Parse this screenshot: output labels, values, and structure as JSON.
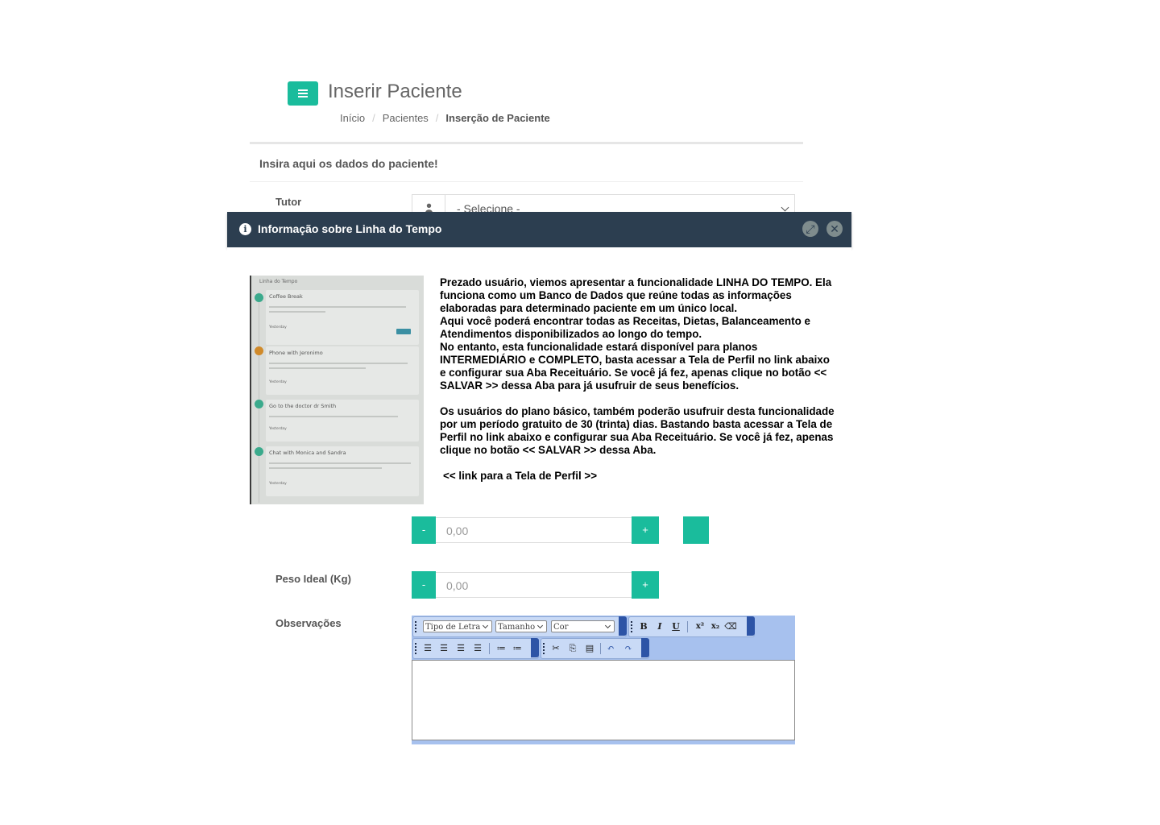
{
  "header": {
    "menu_icon": "bars-icon",
    "title": "Inserir Paciente",
    "breadcrumb": [
      "Início",
      "Pacientes",
      "Inserção de Paciente"
    ],
    "breadcrumb_sep": "/"
  },
  "panel": {
    "heading": "Insira aqui os dados do paciente!"
  },
  "form": {
    "tutor": {
      "label": "Tutor",
      "value": "- Selecione -",
      "icon": "user-icon"
    },
    "peso_atual": {
      "value": "0,00",
      "minus": "-",
      "plus": "+"
    },
    "peso_ideal": {
      "label": "Peso Ideal (Kg)",
      "value": "0,00",
      "minus": "-",
      "plus": "+"
    },
    "observacoes": {
      "label": "Observações"
    }
  },
  "editor": {
    "font_select": "Tipo de Letra",
    "size_select": "Tamanho",
    "color_select": "Cor",
    "bold": "B",
    "italic": "I",
    "underline": "U"
  },
  "modal": {
    "title": "Informação sobre Linha do Tempo",
    "icons": [
      "info-icon",
      "expand-icon",
      "close-icon"
    ],
    "paragraph1": "Prezado usuário, viemos apresentar a funcionalidade LINHA DO TEMPO. Ela funciona como um Banco de Dados que reúne todas as informações elaboradas para determinado paciente em um único local.",
    "paragraph2": "Aqui você poderá encontrar todas as Receitas, Dietas, Balanceamento e Atendimentos disponibilizados ao longo do tempo.",
    "paragraph3": "No entanto, esta funcionalidade estará disponível para planos INTERMEDIÁRIO e COMPLETO, basta acessar a Tela de Perfil no link abaixo e configurar sua Aba Receituário. Se você já fez, apenas clique no botão << SALVAR >> dessa Aba para já usufruir de seus benefícios.",
    "paragraph4": "Os usuários do plano básico, também poderão usufruir desta funcionalidade por um período gratuito de 30 (trinta) dias. Bastando basta acessar a Tela de Perfil no link abaixo e configurar sua Aba Receituário. Se você já fez, apenas clique no botão << SALVAR >> dessa Aba.",
    "link": "<< link para a Tela de Perfil >>",
    "screenshot": {
      "heading": "Linha do Tempo",
      "items": [
        {
          "title": "Coffee Break",
          "date": "Yesterday",
          "color": "#3aaa8c"
        },
        {
          "title": "Phone with Jeronimo",
          "date": "Yesterday",
          "color": "#d08a2a"
        },
        {
          "title": "Go to the doctor dr Smith",
          "date": "Yesterday",
          "color": "#3aaa8c"
        },
        {
          "title": "Chat with Monica and Sandra",
          "date": "Yesterday",
          "color": "#3aaa8c"
        }
      ]
    }
  },
  "colors": {
    "accent": "#1abc9c",
    "modal_bar": "#2c3e50",
    "editor_toolbar": "#a7c1ee"
  }
}
